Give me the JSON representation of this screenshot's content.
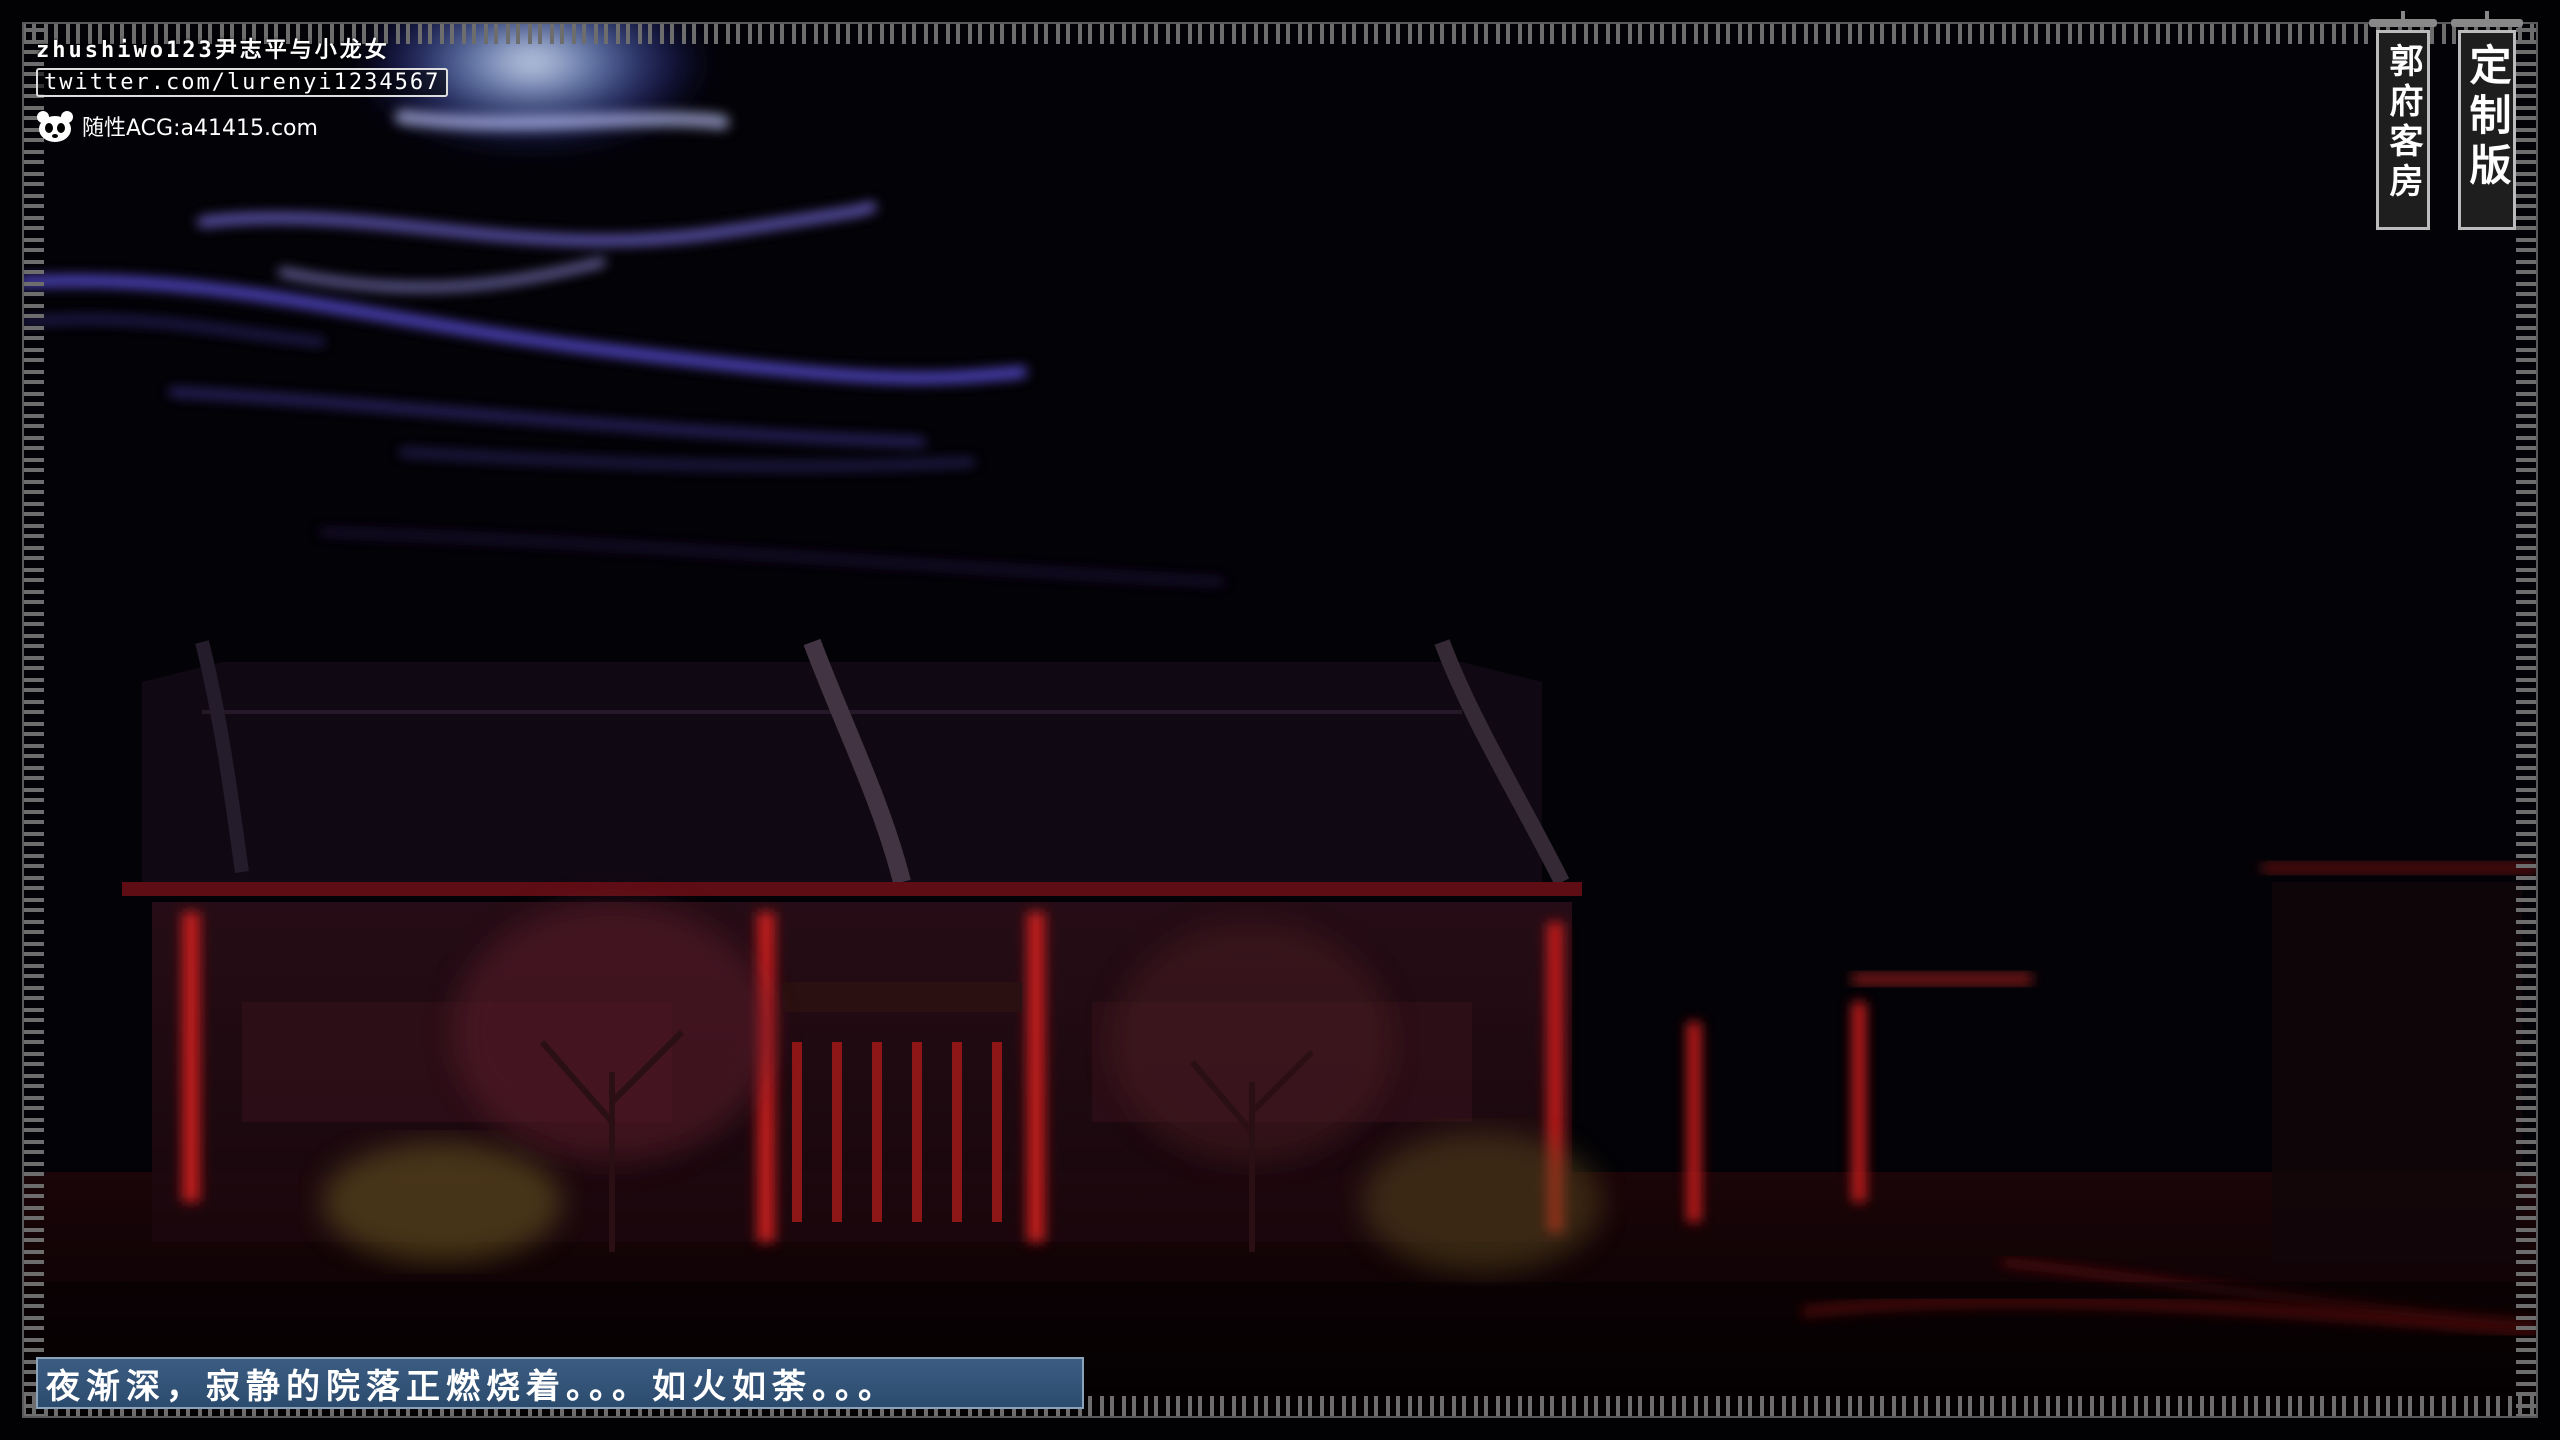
{
  "watermark": {
    "line1": "zhushiwo123尹志平与小龙女",
    "line2": "twitter.com/lurenyi1234567",
    "line3": "随性ACG:a41415.com",
    "logo_icon": "panda-icon"
  },
  "banners": {
    "location": "郭府客房",
    "edition": "定制版"
  },
  "dialogue": {
    "text": "夜渐深，寂静的院落正燃烧着。。。如火如荼。。。"
  },
  "colors": {
    "subtitle_bg": "#2f5073",
    "subtitle_border": "#8ba2b8",
    "pillar_red": "#c01c1c",
    "sky_glow": "#6b5cff",
    "banner_bg": "#1e1e1e"
  }
}
